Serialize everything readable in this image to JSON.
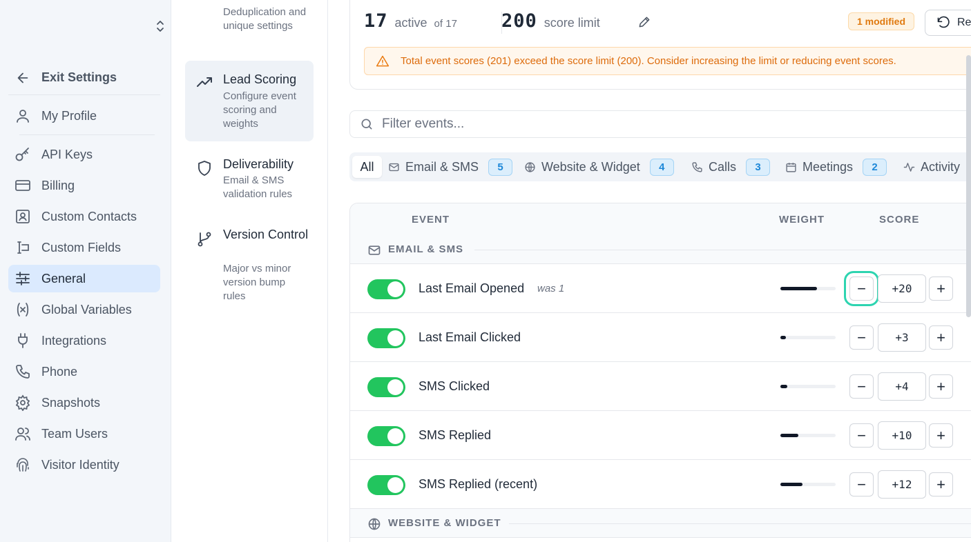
{
  "sidebar": {
    "exit_label": "Exit Settings",
    "items": [
      {
        "label": "My Profile",
        "icon": "user-icon"
      },
      {
        "label": "API Keys",
        "icon": "key-icon"
      },
      {
        "label": "Billing",
        "icon": "credit-card-icon"
      },
      {
        "label": "Custom Contacts",
        "icon": "contact-icon"
      },
      {
        "label": "Custom Fields",
        "icon": "text-cursor-icon"
      },
      {
        "label": "General",
        "icon": "sliders-icon",
        "active": true
      },
      {
        "label": "Global Variables",
        "icon": "variable-icon"
      },
      {
        "label": "Integrations",
        "icon": "plug-icon"
      },
      {
        "label": "Phone",
        "icon": "phone-icon"
      },
      {
        "label": "Snapshots",
        "icon": "gear-icon"
      },
      {
        "label": "Team Users",
        "icon": "users-icon"
      },
      {
        "label": "Visitor Identity",
        "icon": "fingerprint-icon"
      }
    ]
  },
  "subnav": {
    "top_desc": "Deduplication and unique settings",
    "items": [
      {
        "title": "Lead Scoring",
        "desc": "Configure event scoring and weights",
        "icon": "trending-up-icon",
        "active": true
      },
      {
        "title": "Deliverability",
        "desc": "Email & SMS validation rules",
        "icon": "shield-icon"
      },
      {
        "title": "Version Control",
        "desc": "Major vs minor version bump rules",
        "icon": "git-branch-icon"
      }
    ]
  },
  "summary": {
    "active_count": "17",
    "active_label": "active",
    "of_total": "of 17",
    "score_limit": "200",
    "score_limit_label": "score limit",
    "modified_badge": "1 modified",
    "reset_label": "Reset",
    "warning": "Total event scores (201) exceed the score limit (200). Consider increasing the limit or reducing event scores."
  },
  "search": {
    "placeholder": "Filter events..."
  },
  "tabs": [
    {
      "label": "All",
      "active": true
    },
    {
      "label": "Email & SMS",
      "count": "5",
      "icon": "mail-icon"
    },
    {
      "label": "Website & Widget",
      "count": "4",
      "icon": "globe-icon"
    },
    {
      "label": "Calls",
      "count": "3",
      "icon": "phone-icon"
    },
    {
      "label": "Meetings",
      "count": "2",
      "icon": "calendar-icon"
    },
    {
      "label": "Activity",
      "icon": "activity-icon"
    }
  ],
  "table": {
    "headers": {
      "event": "EVENT",
      "weight": "WEIGHT",
      "score": "SCORE"
    },
    "groups": [
      {
        "label": "EMAIL & SMS",
        "icon": "mail-icon",
        "rows": [
          {
            "name": "Last Email Opened",
            "was": "was 1",
            "enabled": true,
            "weight": 0.66,
            "score": "+20"
          },
          {
            "name": "Last Email Clicked",
            "enabled": true,
            "weight": 0.1,
            "score": "+3"
          },
          {
            "name": "SMS Clicked",
            "enabled": true,
            "weight": 0.13,
            "score": "+4"
          },
          {
            "name": "SMS Replied",
            "enabled": true,
            "weight": 0.33,
            "score": "+10"
          },
          {
            "name": "SMS Replied (recent)",
            "enabled": true,
            "weight": 0.4,
            "score": "+12"
          }
        ]
      },
      {
        "label": "WEBSITE & WIDGET",
        "icon": "globe-icon",
        "rows": []
      }
    ]
  },
  "colors": {
    "accent": "#dbeafe",
    "toggle_on": "#22c55e",
    "warning": "#dd6b0b",
    "badge": "#1e88d8",
    "focus": "#2dd4b0"
  }
}
